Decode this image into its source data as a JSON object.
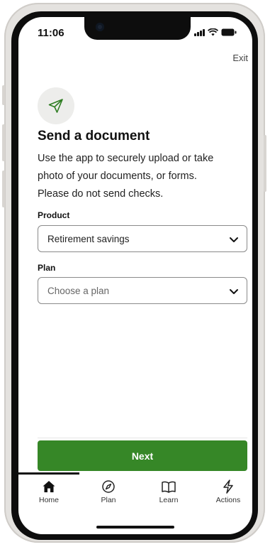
{
  "status_bar": {
    "time": "11:06"
  },
  "header": {
    "exit_label": "Exit"
  },
  "hero": {
    "icon": "paper-plane-icon"
  },
  "content": {
    "title": "Send a document",
    "description": "Use the app to securely upload or take photo of your documents, or forms.",
    "note": "Please do not send checks."
  },
  "form": {
    "product": {
      "label": "Product",
      "value": "Retirement savings"
    },
    "plan": {
      "label": "Plan",
      "placeholder": "Choose a plan"
    }
  },
  "actions": {
    "next_label": "Next"
  },
  "tabs": [
    {
      "label": "Home",
      "icon": "home-icon",
      "active": true
    },
    {
      "label": "Plan",
      "icon": "compass-icon"
    },
    {
      "label": "Learn",
      "icon": "book-icon"
    },
    {
      "label": "Actions",
      "icon": "bolt-icon"
    }
  ],
  "colors": {
    "accent": "#368727",
    "text": "#1a1a1a"
  }
}
